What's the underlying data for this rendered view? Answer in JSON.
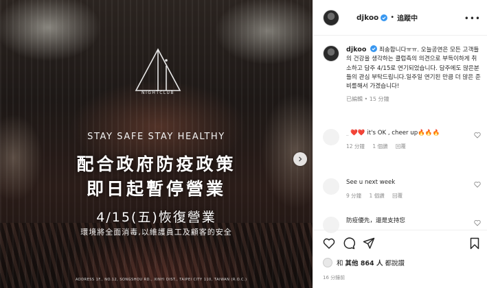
{
  "post_image": {
    "logo_text": "NIGHTCLUB",
    "stay_text": "STAY SAFE  STAY HEALTHY",
    "headline_1": "配合政府防疫政策",
    "headline_2": "即日起暫停營業",
    "reopen_date": "4/15(五)恢復營業",
    "subtext": "環境將全面消毒,以維護員工及顧客的安全",
    "address": "ADDRESS  1F., NO.12, SONGSHOU RD., XINYI DIST., TAIPEI CITY 110, TAIWAN (R.O.C.)"
  },
  "header": {
    "username": "djkoo",
    "separator": "•",
    "follow_label": "追蹤中",
    "more": "•••"
  },
  "caption": {
    "username": "djkoo",
    "text": "죄송합니다ㅠㅠ. 오늘공연은 모든 고객들의 건강을 생각하는 클럽측의 의견으로 부득이하게 취소하고 담주 4/15로 연기되었습니다. 담주에도 많은분들의 관심 부탁드립니다.일주일 연기된 만큼 더 많은 준비를해서 가겠습니다!",
    "meta": "已編輯 • 15 分鐘"
  },
  "comments": [
    {
      "user": "_",
      "text": "❤️❤️ it's OK , cheer up🔥🔥🔥",
      "time": "12 分鐘",
      "likes": "1 個讚",
      "reply": "回覆"
    },
    {
      "user": "",
      "text": "See u next week",
      "time": "9 分鐘",
      "likes": "1 個讚",
      "reply": "回覆"
    },
    {
      "user": "",
      "text": "防疫優先，還是支持您",
      "time": "",
      "likes": "",
      "reply": ""
    }
  ],
  "likes": {
    "prefix": "和",
    "count_text": "其他 864 人",
    "suffix": "都說讚"
  },
  "timestamp": "16 分鐘前",
  "colors": {
    "verified": "#3897f0",
    "text": "#262626",
    "meta": "#8e8e8e"
  },
  "icons": [
    "next-arrow-icon",
    "verified-badge-icon",
    "more-options-icon",
    "heart-icon",
    "comment-icon",
    "share-icon",
    "bookmark-icon"
  ]
}
